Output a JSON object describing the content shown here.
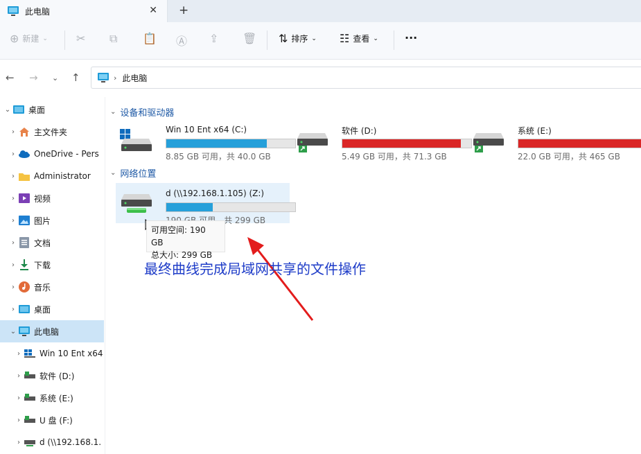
{
  "window": {
    "tab_title": "此电脑",
    "close_glyph": "✕",
    "new_tab_glyph": "+"
  },
  "toolbar": {
    "new_label": "新建",
    "sort_label": "排序",
    "view_label": "查看",
    "more_glyph": "···"
  },
  "address": {
    "path": "此电脑"
  },
  "sidebar": {
    "items": [
      {
        "label": "桌面",
        "icon": "desktop-icon"
      },
      {
        "label": "主文件夹",
        "icon": "home-icon"
      },
      {
        "label": "OneDrive - Pers",
        "icon": "cloud-icon"
      },
      {
        "label": "Administrator",
        "icon": "folder-icon"
      },
      {
        "label": "视频",
        "icon": "video-icon"
      },
      {
        "label": "图片",
        "icon": "picture-icon"
      },
      {
        "label": "文档",
        "icon": "document-icon"
      },
      {
        "label": "下载",
        "icon": "download-icon"
      },
      {
        "label": "音乐",
        "icon": "music-icon"
      },
      {
        "label": "桌面",
        "icon": "desktop-icon"
      },
      {
        "label": "此电脑",
        "icon": "computer-icon"
      },
      {
        "label": "Win 10 Ent x64",
        "icon": "windows-drive-icon"
      },
      {
        "label": "软件 (D:)",
        "icon": "drive-icon"
      },
      {
        "label": "系统 (E:)",
        "icon": "drive-icon"
      },
      {
        "label": "U 盘 (F:)",
        "icon": "drive-icon"
      },
      {
        "label": "d (\\\\192.168.1.",
        "icon": "network-drive-icon"
      }
    ]
  },
  "content": {
    "devices_header": "设备和驱动器",
    "network_header": "网络位置",
    "drives": [
      {
        "name": "Win 10 Ent x64 (C:)",
        "free": "8.85 GB 可用，共 40.0 GB",
        "used_fraction": 0.78,
        "bar_color": "#26a0da"
      },
      {
        "name": "软件 (D:)",
        "free": "5.49 GB 可用，共 71.3 GB",
        "used_fraction": 0.92,
        "bar_color": "#da2626"
      },
      {
        "name": "系统 (E:)",
        "free": "22.0 GB 可用，共 465 GB",
        "used_fraction": 0.95,
        "bar_color": "#da2626"
      }
    ],
    "network_drive": {
      "name": "d (\\\\192.168.1.105) (Z:)",
      "free": "190 GB 可用，共 299 GB",
      "used_fraction": 0.36,
      "bar_color": "#26a0da"
    },
    "tooltip": {
      "line1": "可用空间: 190 GB",
      "line2": "总大小: 299 GB"
    },
    "annotation": "最终曲线完成局域网共享的文件操作"
  }
}
